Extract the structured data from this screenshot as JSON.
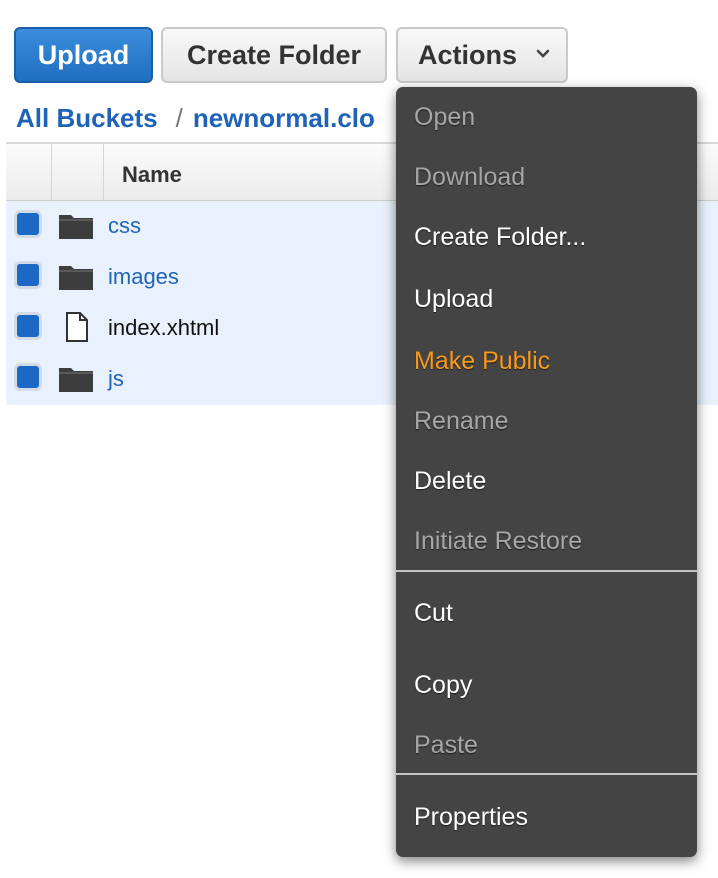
{
  "toolbar": {
    "upload_label": "Upload",
    "create_folder_label": "Create Folder",
    "actions_label": "Actions"
  },
  "breadcrumb": {
    "root": "All Buckets",
    "separator": "/",
    "bucket": "newnormal.clo"
  },
  "table": {
    "header_name": "Name",
    "rows": [
      {
        "name": "css",
        "type": "folder"
      },
      {
        "name": "images",
        "type": "folder"
      },
      {
        "name": "index.xhtml",
        "type": "file"
      },
      {
        "name": "js",
        "type": "folder"
      }
    ]
  },
  "actions_menu": {
    "items": [
      {
        "label": "Open",
        "state": "disabled"
      },
      {
        "label": "Download",
        "state": "disabled"
      },
      {
        "label": "Create Folder...",
        "state": "enabled"
      },
      {
        "label": "Upload",
        "state": "enabled"
      },
      {
        "label": "Make Public",
        "state": "highlighted"
      },
      {
        "label": "Rename",
        "state": "disabled"
      },
      {
        "label": "Delete",
        "state": "enabled"
      },
      {
        "label": "Initiate Restore",
        "state": "disabled"
      },
      {
        "label": "Cut",
        "state": "enabled"
      },
      {
        "label": "Copy",
        "state": "enabled"
      },
      {
        "label": "Paste",
        "state": "disabled"
      },
      {
        "label": "Properties",
        "state": "enabled"
      }
    ]
  },
  "colors": {
    "primary": "#1f6fc2",
    "link": "#1e63b8",
    "menu_bg": "#444444",
    "highlight": "#f79a1e",
    "selected_row": "#e9f2fc"
  },
  "icons": {
    "folder": "folder-icon",
    "file": "file-icon",
    "dropdown": "chevron-down-icon"
  }
}
